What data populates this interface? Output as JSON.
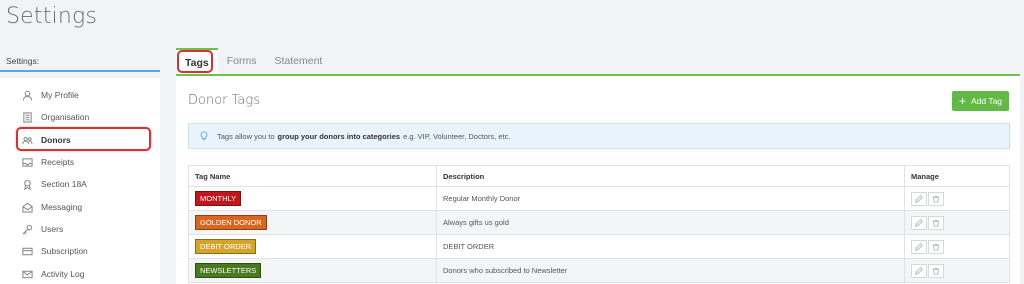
{
  "page": {
    "title": "Settings"
  },
  "sidebar": {
    "header": "Settings:",
    "items": [
      {
        "label": "My Profile",
        "icon": "user-icon"
      },
      {
        "label": "Organisation",
        "icon": "building-icon"
      },
      {
        "label": "Donors",
        "icon": "users-icon",
        "active": true
      },
      {
        "label": "Receipts",
        "icon": "inbox-icon"
      },
      {
        "label": "Section 18A",
        "icon": "certificate-icon"
      },
      {
        "label": "Messaging",
        "icon": "envelope-open-icon"
      },
      {
        "label": "Users",
        "icon": "key-icon"
      },
      {
        "label": "Subscription",
        "icon": "card-icon"
      },
      {
        "label": "Activity Log",
        "icon": "mail-icon"
      }
    ]
  },
  "tabs": [
    {
      "label": "Tags",
      "active": true
    },
    {
      "label": "Forms"
    },
    {
      "label": "Statement"
    }
  ],
  "content": {
    "title": "Donor Tags",
    "add_button": "Add Tag",
    "info": {
      "prefix": "Tags allow you to",
      "bold": "group your donors into categories",
      "suffix": "e.g. VIP, Volunteer, Doctors, etc."
    },
    "table": {
      "headers": [
        "Tag Name",
        "Description",
        "Manage"
      ],
      "rows": [
        {
          "tag": "MONTHLY",
          "color": "#c0161c",
          "description": "Regular Monthly Donor"
        },
        {
          "tag": "GOLDEN DONOR",
          "color": "#d9661e",
          "description": "Always gifts us gold"
        },
        {
          "tag": "DEBIT ORDER",
          "color": "#d4a52a",
          "description": "DEBIT ORDER"
        },
        {
          "tag": "NEWSLETTERS",
          "color": "#4a7a1e",
          "description": "Donors who subscribed to Newsletter"
        }
      ]
    }
  },
  "colors": {
    "accent_green": "#63b946",
    "tab_line": "#6fc04b",
    "highlight_red": "#d9312f",
    "info_bg": "#e8f3fb"
  }
}
